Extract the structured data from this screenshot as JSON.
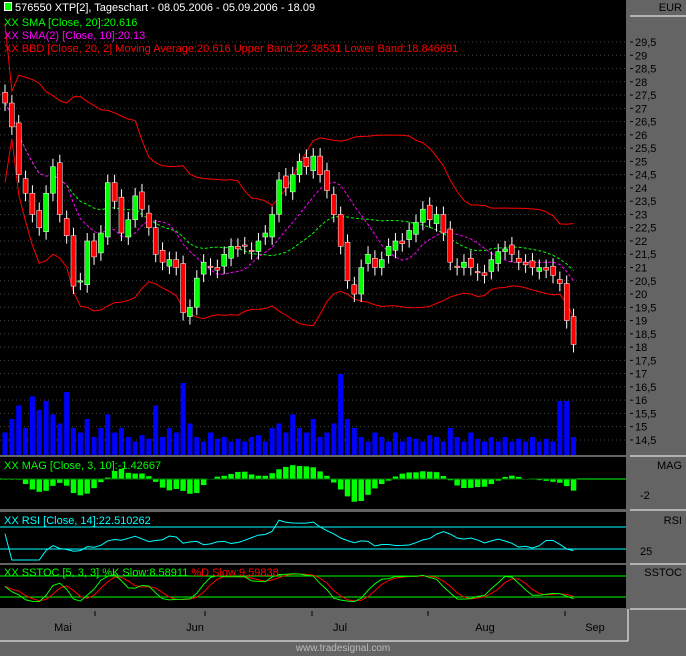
{
  "header": {
    "title": "576550 XTP[2], Tageschart - 08.05.2006 - 05.09.2006 - 18.09",
    "sma20": "SMA [Close, 20]:20.616",
    "sma10": "SMA(2) [Close, 10]:20.13",
    "bbd": "BBD [Close, 20, 2] Moving Average:20.616 Upper Band:22.38531 Lower Band:18.846691",
    "xx": "XX"
  },
  "panels": {
    "price_unit": "EUR",
    "mag_label": "MAG",
    "rsi_label": "RSI",
    "sstoc_label": "SSTOC",
    "mag_title": "MAG [Close, 3, 10]:-1.42667",
    "rsi_title": "RSI [Close, 14]:22.510262",
    "sstoc_k": "SSTOC [5, 3, 3] %K Slow:8.58911",
    "sstoc_d": "%D Slow:9.59838",
    "mag_tick": "-2",
    "rsi_tick": "25"
  },
  "months": [
    "Mai",
    "Jun",
    "Jul",
    "Aug",
    "Sep"
  ],
  "footer": "www.tradesignal.com",
  "colors": {
    "up": "#00ff00",
    "down": "#ff0000",
    "sma20": "#00ff00",
    "sma10": "#ff00ff",
    "bands": "#ff0000",
    "volume": "#0000ff",
    "rsi": "#00ffff"
  },
  "chart_data": {
    "type": "candlestick",
    "ylim": [
      14,
      30
    ],
    "yticks": [
      "29,5",
      "29",
      "28,5",
      "28",
      "27,5",
      "27",
      "26,5",
      "26",
      "25,5",
      "25",
      "24,5",
      "24",
      "23,5",
      "23",
      "22,5",
      "22",
      "21,5",
      "21",
      "20,5",
      "20",
      "19,5",
      "19",
      "18,5",
      "18",
      "17,5",
      "17",
      "16,5",
      "16",
      "15,5",
      "15",
      "14,5"
    ],
    "close": [
      27.2,
      26.3,
      24.5,
      23.8,
      23.0,
      22.5,
      23.8,
      24.8,
      23.0,
      22.2,
      20.3,
      20.5,
      22.0,
      21.4,
      22.3,
      24.2,
      23.5,
      22.3,
      22.8,
      23.7,
      23.2,
      22.5,
      21.5,
      21.2,
      21.3,
      21.0,
      19.3,
      19.5,
      20.6,
      21.2,
      21.0,
      20.9,
      21.5,
      21.8,
      21.7,
      21.8,
      21.6,
      22.0,
      22.3,
      23.0,
      24.3,
      24.0,
      24.5,
      25.0,
      24.8,
      25.2,
      24.5,
      23.9,
      23.0,
      21.8,
      20.5,
      20.0,
      21.0,
      21.5,
      21.0,
      21.3,
      21.8,
      22.0,
      21.9,
      22.4,
      22.7,
      23.2,
      22.8,
      23.0,
      22.3,
      21.2,
      21.0,
      21.2,
      21.0,
      20.8,
      20.7,
      21.3,
      21.6,
      21.7,
      21.5,
      21.2,
      21.1,
      21.0,
      21.0,
      20.9,
      20.7,
      20.4,
      19.0,
      18.1
    ],
    "volume_relative": [
      25,
      40,
      55,
      30,
      65,
      50,
      60,
      45,
      35,
      70,
      30,
      25,
      40,
      20,
      30,
      45,
      25,
      30,
      20,
      15,
      22,
      18,
      55,
      20,
      30,
      25,
      80,
      35,
      20,
      15,
      25,
      18,
      20,
      15,
      18,
      15,
      20,
      22,
      15,
      30,
      35,
      25,
      45,
      30,
      25,
      40,
      20,
      25,
      35,
      90,
      40,
      30,
      20,
      15,
      25,
      20,
      15,
      25,
      15,
      20,
      18,
      15,
      22,
      20,
      15,
      30,
      20,
      15,
      25,
      18,
      15,
      20,
      15,
      20,
      15,
      18,
      15,
      20,
      15,
      18,
      15,
      60,
      60,
      20
    ],
    "indicators": [
      "SMA 20",
      "SMA 10",
      "Bollinger 20,2",
      "Volume",
      "MAG 3,10",
      "RSI 14",
      "SSTOC 5,3,3"
    ]
  }
}
